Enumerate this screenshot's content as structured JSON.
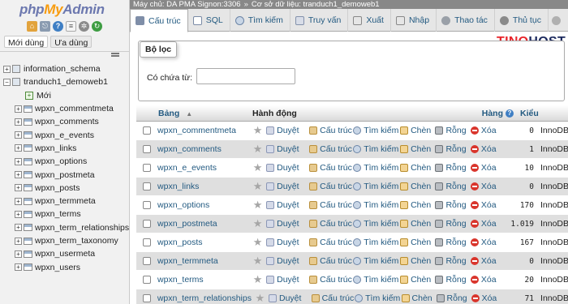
{
  "logo": {
    "php": "php",
    "my": "My",
    "admin": "Admin"
  },
  "nav": {
    "icons": [
      "home-icon",
      "exit-icon",
      "help-icon",
      "docs-icon",
      "gear-icon",
      "reload-icon"
    ],
    "tabs": {
      "recent": "Mới dùng",
      "favorites": "Ưa dùng"
    },
    "tree": {
      "db1": "information_schema",
      "db2": "tranduch1_demoweb1",
      "new": "Mới",
      "tables": [
        "wpxn_commentmeta",
        "wpxn_comments",
        "wpxn_e_events",
        "wpxn_links",
        "wpxn_options",
        "wpxn_postmeta",
        "wpxn_posts",
        "wpxn_termmeta",
        "wpxn_terms",
        "wpxn_term_relationships",
        "wpxn_term_taxonomy",
        "wpxn_usermeta",
        "wpxn_users"
      ]
    }
  },
  "breadcrumb": {
    "server": "Máy chủ: DA PMA Signon:3306",
    "sep": "»",
    "database": "Cơ sở dữ liệu: tranduch1_demoweb1"
  },
  "menu": {
    "structure": "Cấu trúc",
    "sql": "SQL",
    "search": "Tìm kiếm",
    "query": "Truy vấn",
    "export": "Xuất",
    "import": "Nhập",
    "operations": "Thao tác",
    "routines": "Thủ tục"
  },
  "brand": {
    "part1": "TINO",
    "part2": "HOST"
  },
  "filter": {
    "legend": "Bộ lọc",
    "label": "Có chứa từ:",
    "value": ""
  },
  "table": {
    "headers": {
      "name": "Bảng",
      "action": "Hành động",
      "rows": "Hàng",
      "type": "Kiểu"
    },
    "actions": {
      "browse": "Duyệt",
      "structure": "Cấu trúc",
      "search": "Tìm kiếm",
      "insert": "Chèn",
      "empty": "Rỗng",
      "drop": "Xóa"
    },
    "rows": [
      {
        "name": "wpxn_commentmeta",
        "rows": "0",
        "type": "InnoDB"
      },
      {
        "name": "wpxn_comments",
        "rows": "1",
        "type": "InnoDB"
      },
      {
        "name": "wpxn_e_events",
        "rows": "10",
        "type": "InnoDB"
      },
      {
        "name": "wpxn_links",
        "rows": "0",
        "type": "InnoDB"
      },
      {
        "name": "wpxn_options",
        "rows": "170",
        "type": "InnoDB"
      },
      {
        "name": "wpxn_postmeta",
        "rows": "1.019",
        "type": "InnoDB"
      },
      {
        "name": "wpxn_posts",
        "rows": "167",
        "type": "InnoDB"
      },
      {
        "name": "wpxn_termmeta",
        "rows": "0",
        "type": "InnoDB"
      },
      {
        "name": "wpxn_terms",
        "rows": "20",
        "type": "InnoDB"
      },
      {
        "name": "wpxn_term_relationships",
        "rows": "71",
        "type": "InnoDB"
      }
    ]
  }
}
